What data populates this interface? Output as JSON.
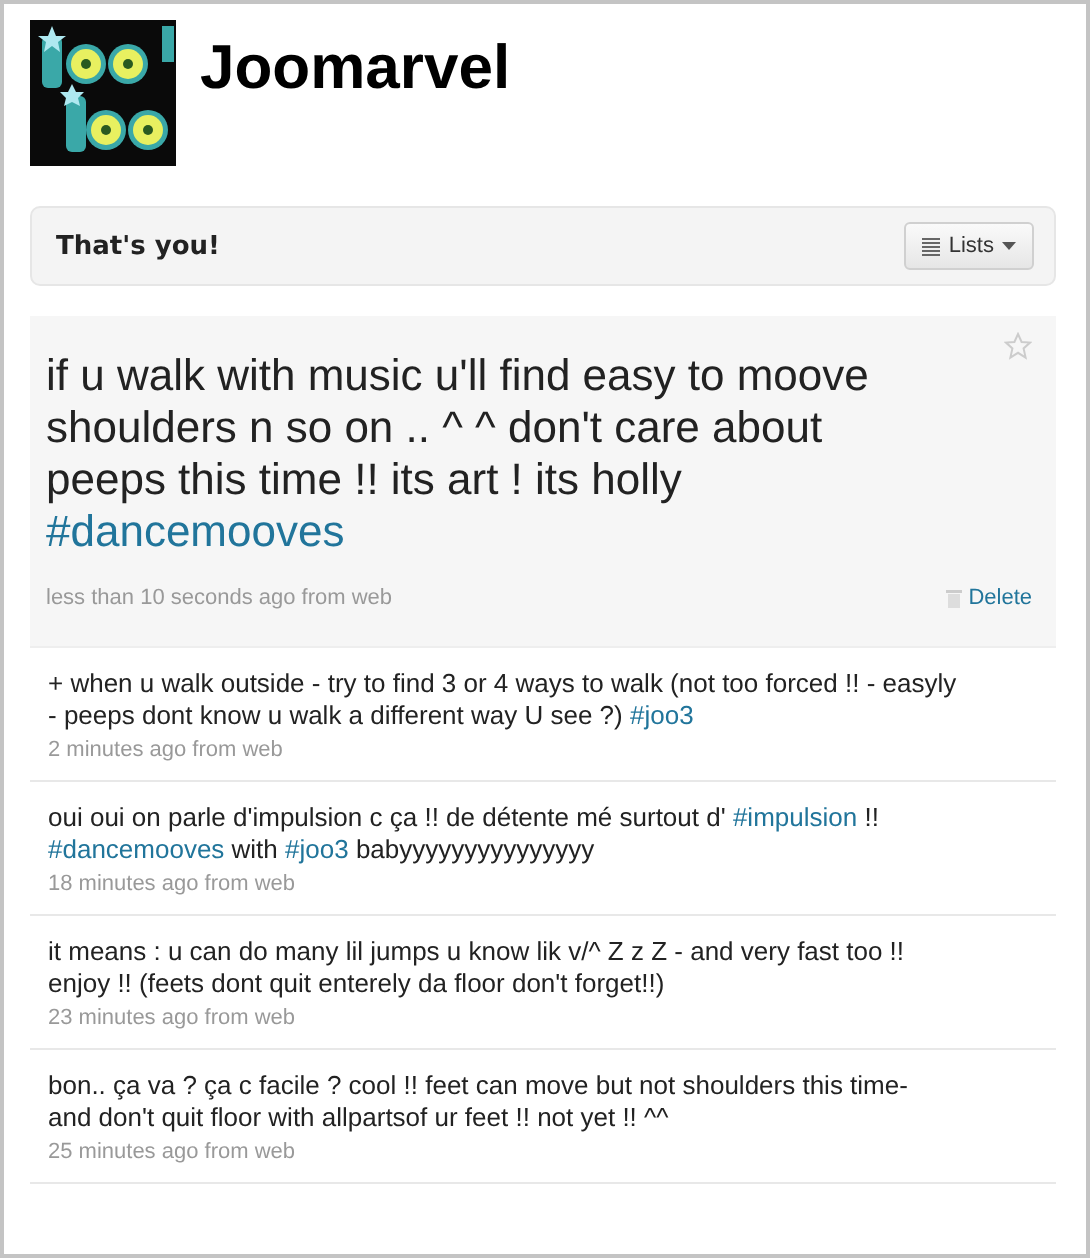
{
  "profile": {
    "name": "Joomarvel"
  },
  "header": {
    "title": "That's you!",
    "lists_button": "Lists"
  },
  "featured": {
    "segments": [
      {
        "kind": "text",
        "text": "if u walk with music u'll find easy to moove shoulders n so on .. ^ ^ don't care about peeps this time !! its art ! its holly "
      },
      {
        "kind": "hashtag",
        "text": "#dancemooves"
      }
    ],
    "meta": "less than 10 seconds ago from web",
    "delete": "Delete",
    "favorited": false
  },
  "tweets": [
    {
      "segments": [
        {
          "kind": "text",
          "text": "+ when u walk outside - try to find 3 or 4 ways to walk (not too forced !! - easyly - peeps dont know u walk a different way U see ?) "
        },
        {
          "kind": "hashtag",
          "text": "#joo3"
        }
      ],
      "meta": "2 minutes ago from web"
    },
    {
      "segments": [
        {
          "kind": "text",
          "text": "oui oui on parle d'impulsion c ça !! de détente mé surtout d' "
        },
        {
          "kind": "hashtag",
          "text": "#impulsion"
        },
        {
          "kind": "text",
          "text": " !! "
        },
        {
          "kind": "hashtag",
          "text": "#dancemooves"
        },
        {
          "kind": "text",
          "text": " with "
        },
        {
          "kind": "hashtag",
          "text": "#joo3"
        },
        {
          "kind": "text",
          "text": " babyyyyyyyyyyyyyyy"
        }
      ],
      "meta": "18 minutes ago from web"
    },
    {
      "segments": [
        {
          "kind": "text",
          "text": "it means : u can do many lil jumps u know lik v/^ Z z Z - and very fast too !! enjoy !! (feets dont quit enterely da floor don't forget!!)"
        }
      ],
      "meta": "23 minutes ago from web"
    },
    {
      "segments": [
        {
          "kind": "text",
          "text": "bon.. ça va ? ça c facile ? cool !! feet can move but not shoulders this time- and don't quit floor with allpartsof ur feet !! not yet !! ^^"
        }
      ],
      "meta": "25 minutes ago from web"
    }
  ]
}
